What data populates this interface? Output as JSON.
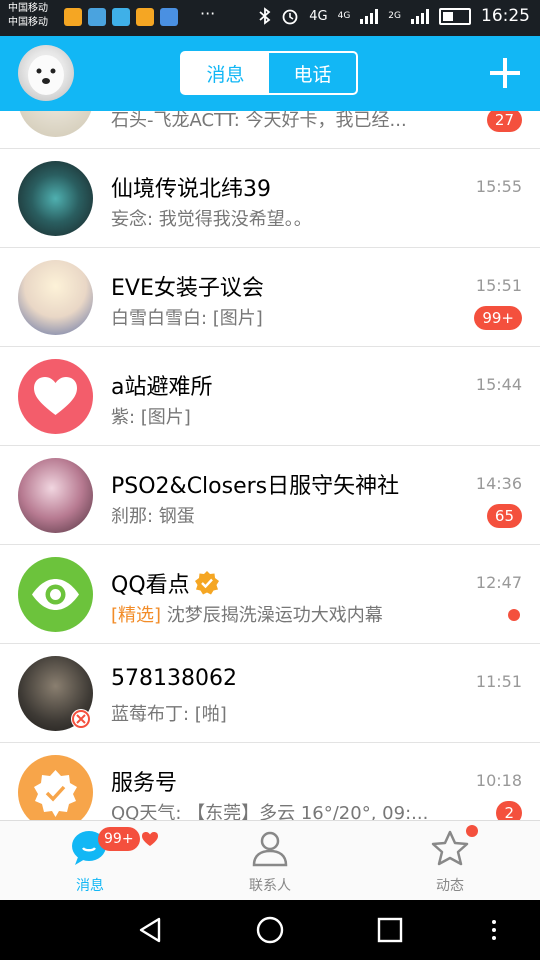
{
  "status_bar": {
    "carrier_1": "中国移动",
    "carrier_2": "中国移动",
    "network_1": "4G",
    "network_2": "4G",
    "network_3": "2G",
    "time": "16:25"
  },
  "header": {
    "tabs": [
      {
        "label": "消息",
        "active": true
      },
      {
        "label": "电话",
        "active": false
      }
    ]
  },
  "conversations": [
    {
      "name": "",
      "preview": "石头-飞龙ACTT: 今天好卡，我已经...",
      "time": "",
      "badge": "27"
    },
    {
      "name": "仙境传说北纬39",
      "preview": "妄念: 我觉得我没希望。。",
      "time": "15:55",
      "badge": ""
    },
    {
      "name": "EVE女装子议会",
      "preview": "白雪白雪白: [图片]",
      "time": "15:51",
      "badge": "99+"
    },
    {
      "name": "a站避难所",
      "preview": "紫: [图片]",
      "time": "15:44",
      "badge": ""
    },
    {
      "name": "PSO2&Closers日服守矢神社",
      "preview": "刹那: 钢蛋",
      "time": "14:36",
      "badge": "65"
    },
    {
      "name": "QQ看点",
      "tag": "[精选]",
      "preview": "沈梦辰揭洗澡运功大戏内幕",
      "time": "12:47",
      "badge": ""
    },
    {
      "name": "578138062",
      "preview": "蓝莓布丁: [啪]",
      "time": "11:51",
      "badge": ""
    },
    {
      "name": "服务号",
      "preview": "QQ天气: 【东莞】多云 16°/20°, 09:...",
      "time": "10:18",
      "badge": "2"
    }
  ],
  "tab_bar": {
    "items": [
      {
        "label": "消息",
        "badge": "99+"
      },
      {
        "label": "联系人"
      },
      {
        "label": "动态"
      }
    ]
  },
  "colors": {
    "accent": "#12b7f5",
    "badge": "#f4503d",
    "featured": "#f28c28"
  }
}
